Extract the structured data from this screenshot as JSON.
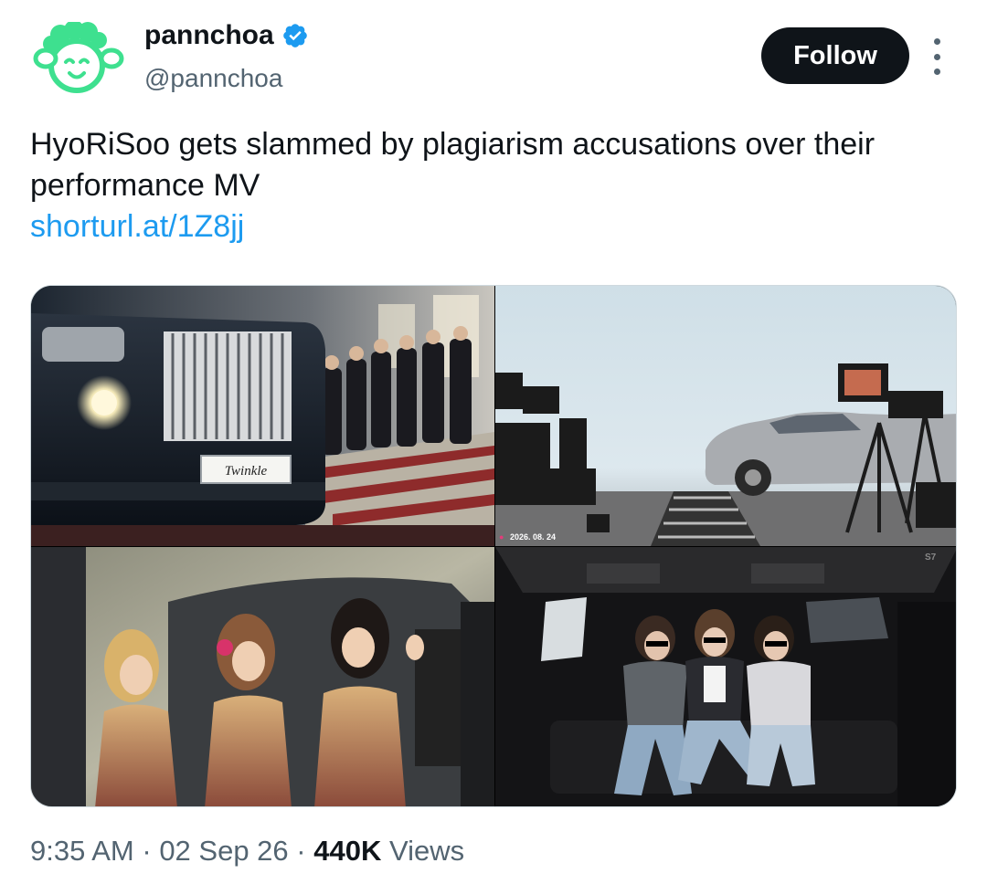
{
  "author": {
    "display_name": "pannchoa",
    "handle": "@pannchoa",
    "verified": true,
    "avatar_icon": "sheep-mascot-icon",
    "avatar_color": "#3ee08f"
  },
  "actions": {
    "follow_label": "Follow",
    "more_icon": "more-vertical-icon"
  },
  "tweet": {
    "text": "HyoRiSoo gets slammed by plagiarism accusations over their performance MV",
    "link": "shorturl.at/1Z8jj"
  },
  "media": {
    "panels": [
      {
        "name": "car-front-stairs-scene",
        "plate_text": "Twinkle"
      },
      {
        "name": "film-set-car-scene",
        "date_overlay": "2026. 08. 24"
      },
      {
        "name": "three-singers-car-scene"
      },
      {
        "name": "three-women-limo-interior-scene"
      }
    ]
  },
  "footer": {
    "time": "9:35 AM",
    "separator": " · ",
    "date": "02 Sep 26",
    "views_count": "440K",
    "views_label": " Views"
  },
  "colors": {
    "text_primary": "#0f1419",
    "text_secondary": "#536471",
    "link": "#1d9bf0",
    "verified_badge": "#1d9bf0"
  }
}
